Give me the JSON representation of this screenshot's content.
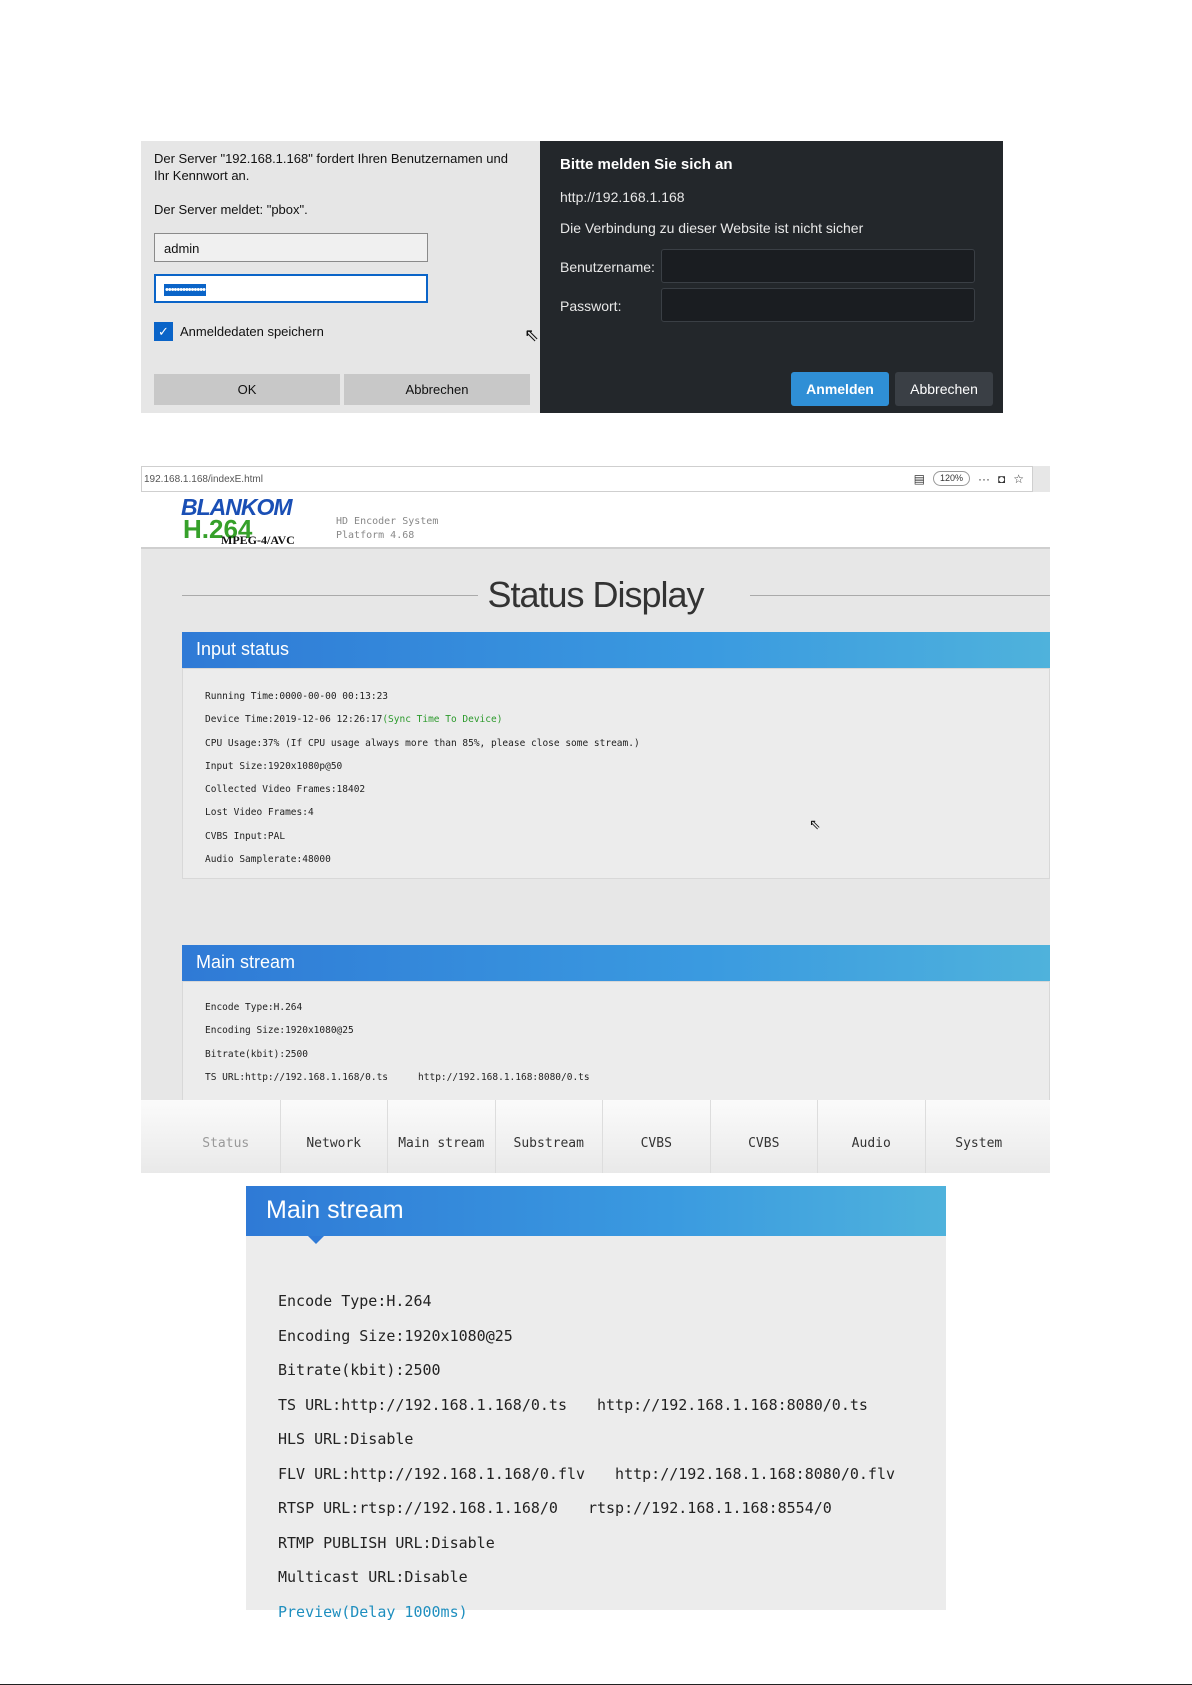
{
  "win_login": {
    "message_line1": "Der Server \"192.168.1.168\" fordert Ihren Benutzernamen und Ihr Kennwort an.",
    "message_line2": "Der Server meldet: \"pbox\".",
    "username_value": "admin",
    "password_value": "••••••••••••••",
    "remember_label": "Anmeldedaten speichern",
    "ok_label": "OK",
    "cancel_label": "Abbrechen"
  },
  "chrome_login": {
    "heading": "Bitte melden Sie sich an",
    "url": "http://192.168.1.168",
    "warning": "Die Verbindung zu dieser Website ist nicht sicher",
    "username_label": "Benutzername:",
    "password_label": "Passwort:",
    "submit_label": "Anmelden",
    "cancel_label": "Abbrechen"
  },
  "browser": {
    "address": "192.168.1.168/indexE.html",
    "zoom": "120%",
    "more": "···",
    "logo_brand": "BLANKOM",
    "logo_codec": "H.264",
    "logo_sub": "MPEG-4/AVC",
    "product_line1": "HD Encoder System",
    "product_line2": "Platform 4.68",
    "page_title": "Status Display",
    "input_status": {
      "title": "Input status",
      "running_time": "Running Time:0000-00-00 00:13:23",
      "device_time": "Device Time:2019-12-06 12:26:17",
      "sync_link": "(Sync Time To Device)",
      "cpu_usage": "CPU Usage:37% (If CPU usage always more than 85%, please close some stream.)",
      "input_size": "Input Size:1920x1080p@50",
      "collected_frames": "Collected Video Frames:18402",
      "lost_frames": "Lost Video Frames:4",
      "cvbs_input": "CVBS Input:PAL",
      "audio_samplerate": "Audio Samplerate:48000"
    },
    "main_stream_small": {
      "title": "Main stream",
      "encode_type": "Encode Type:H.264",
      "encoding_size": "Encoding Size:1920x1080@25",
      "bitrate": "Bitrate(kbit):2500",
      "ts_url": "TS URL:http://192.168.1.168/0.ts",
      "ts_url_alt": "http://192.168.1.168:8080/0.ts"
    },
    "nav": [
      "Status",
      "Network",
      "Main stream",
      "Substream",
      "CVBS",
      "CVBS",
      "Audio",
      "System"
    ]
  },
  "main_stream_zoom": {
    "title": "Main stream",
    "encode_type": "Encode Type:H.264",
    "encoding_size": "Encoding Size:1920x1080@25",
    "bitrate": "Bitrate(kbit):2500",
    "ts_url": "TS URL:http://192.168.1.168/0.ts",
    "ts_url_alt": "http://192.168.1.168:8080/0.ts",
    "hls_url": "HLS URL:Disable",
    "flv_url": "FLV URL:http://192.168.1.168/0.flv",
    "flv_url_alt": "http://192.168.1.168:8080/0.flv",
    "rtsp_url": "RTSP URL:rtsp://192.168.1.168/0",
    "rtsp_url_alt": "rtsp://192.168.1.168:8554/0",
    "rtmp_url": "RTMP PUBLISH URL:Disable",
    "multicast_url": "Multicast URL:Disable",
    "preview": "Preview(Delay 1000ms)"
  },
  "colors": {
    "accent_blue": "#2f7ad6",
    "green_link": "#2c9a2c",
    "preview_link": "#1f8fbf",
    "dark_dialog": "#23272b"
  }
}
